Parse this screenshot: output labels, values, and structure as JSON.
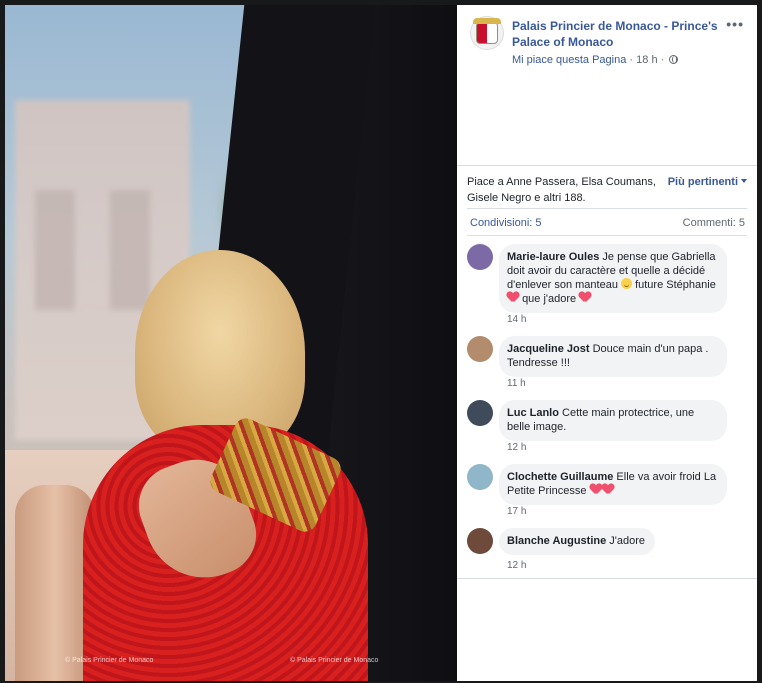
{
  "photo": {
    "watermark_left": "© Palais Princier de Monaco",
    "watermark_right": "© Palais Princier de Monaco"
  },
  "post": {
    "page_name": "Palais Princier de Monaco - Prince's Palace of Monaco",
    "page_like_label": "Mi piace questa Pagina",
    "separator": "·",
    "time": "18 h",
    "menu_icon": "more-options-icon",
    "privacy_icon": "globe-icon"
  },
  "reactions": {
    "likes_text": "Piace a Anne Passera, Elsa Coumans, Gisele Negro e altri 188.",
    "sort_label": "Più pertinenti",
    "shares": "Condivisioni: 5",
    "comments": "Commenti: 5"
  },
  "comments": [
    {
      "author": "Marie-laure Oules",
      "text_1": "Je pense que Gabriella doit avoir du caractère et quelle a décidé d'enlever son manteau",
      "text_2": "future Stéphanie",
      "text_3": "que j'adore",
      "time": "14 h",
      "avatar_color": "#7c6aa6"
    },
    {
      "author": "Jacqueline Jost",
      "text": "Douce main d'un papa . Tendresse !!!",
      "time": "11 h",
      "avatar_color": "#b38b6d"
    },
    {
      "author": "Luc Lanlo",
      "text": "Cette main protectrice, une belle image.",
      "time": "12 h",
      "avatar_color": "#3f4a5a"
    },
    {
      "author": "Clochette Guillaume",
      "text": "Elle va avoir froid La Petite Princesse",
      "time": "17 h",
      "avatar_color": "#8fb6c9"
    },
    {
      "author": "Blanche Augustine",
      "text": "J'adore",
      "time": "12 h",
      "avatar_color": "#6e4a3a"
    }
  ],
  "colors": {
    "link": "#385898",
    "bubble": "#f2f3f5",
    "heart": "#f0506e"
  }
}
